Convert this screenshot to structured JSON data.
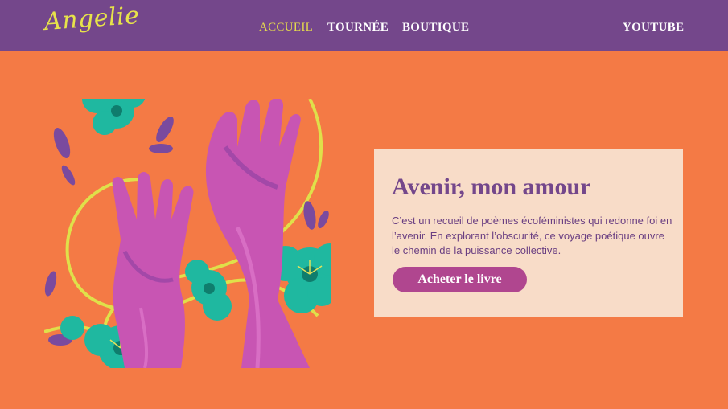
{
  "brand": {
    "logo_text": "Angelie"
  },
  "nav": {
    "links": [
      {
        "label": "ACCUEIL",
        "active": true
      },
      {
        "label": "TOURNÉE",
        "active": false
      },
      {
        "label": "BOUTIQUE",
        "active": false
      }
    ],
    "youtube_label": "YOUTUBE"
  },
  "hero": {
    "illustration_icon": "hands-flowers-illustration",
    "title": "Avenir, mon amour",
    "description": "C’est un recueil de poèmes écoféministes qui redonne foi en l’avenir. En explorant l’obscurité, ce voyage poétique ouvre le chemin de la puissance collective.",
    "cta_label": "Acheter le livre"
  },
  "colors": {
    "page_background": "#f47a45",
    "navbar": "#74478b",
    "accent_yellow": "#e6dc4c",
    "card_background": "#f8dcc8",
    "title_purple": "#74478b",
    "button": "#b0468f",
    "flower_teal": "#1fb8a0",
    "hand_pink": "#c855b3"
  }
}
